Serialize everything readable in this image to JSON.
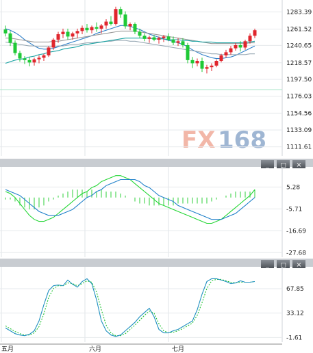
{
  "chart_data": [
    {
      "type": "candlestick",
      "panel": "price",
      "ylim": [
        1100,
        1295
      ],
      "yticks": [
        1283.39,
        1261.52,
        1240.65,
        1218.57,
        1197.5,
        1176.03,
        1154.56,
        1133.09,
        1111.61
      ],
      "candles": [
        [
          1261,
          1266,
          1252,
          1256
        ],
        [
          1256,
          1259,
          1240,
          1244
        ],
        [
          1244,
          1247,
          1228,
          1231
        ],
        [
          1231,
          1234,
          1220,
          1224
        ],
        [
          1224,
          1227,
          1217,
          1222
        ],
        [
          1222,
          1226,
          1214,
          1219
        ],
        [
          1219,
          1225,
          1215,
          1223
        ],
        [
          1223,
          1228,
          1218,
          1225
        ],
        [
          1225,
          1230,
          1221,
          1228
        ],
        [
          1228,
          1240,
          1226,
          1238
        ],
        [
          1238,
          1250,
          1235,
          1248
        ],
        [
          1248,
          1258,
          1244,
          1255
        ],
        [
          1255,
          1262,
          1250,
          1258
        ],
        [
          1258,
          1262,
          1248,
          1252
        ],
        [
          1252,
          1258,
          1248,
          1256
        ],
        [
          1256,
          1262,
          1250,
          1259
        ],
        [
          1259,
          1266,
          1255,
          1263
        ],
        [
          1263,
          1268,
          1257,
          1260
        ],
        [
          1260,
          1266,
          1256,
          1264
        ],
        [
          1264,
          1270,
          1258,
          1262
        ],
        [
          1262,
          1268,
          1256,
          1266
        ],
        [
          1266,
          1274,
          1262,
          1271
        ],
        [
          1271,
          1278,
          1266,
          1268
        ],
        [
          1268,
          1290,
          1266,
          1287
        ],
        [
          1287,
          1290,
          1276,
          1280
        ],
        [
          1280,
          1284,
          1262,
          1265
        ],
        [
          1265,
          1270,
          1260,
          1268
        ],
        [
          1268,
          1270,
          1255,
          1258
        ],
        [
          1258,
          1262,
          1250,
          1253
        ],
        [
          1253,
          1256,
          1246,
          1249
        ],
        [
          1249,
          1253,
          1244,
          1251
        ],
        [
          1251,
          1254,
          1246,
          1248
        ],
        [
          1248,
          1252,
          1243,
          1250
        ],
        [
          1250,
          1254,
          1245,
          1252
        ],
        [
          1252,
          1256,
          1246,
          1248
        ],
        [
          1248,
          1252,
          1241,
          1244
        ],
        [
          1244,
          1250,
          1240,
          1246
        ],
        [
          1246,
          1250,
          1238,
          1241
        ],
        [
          1241,
          1244,
          1218,
          1222
        ],
        [
          1222,
          1226,
          1212,
          1218
        ],
        [
          1218,
          1224,
          1214,
          1221
        ],
        [
          1221,
          1225,
          1207,
          1211
        ],
        [
          1211,
          1216,
          1205,
          1213
        ],
        [
          1213,
          1218,
          1208,
          1215
        ],
        [
          1215,
          1223,
          1213,
          1221
        ],
        [
          1221,
          1230,
          1219,
          1228
        ],
        [
          1228,
          1235,
          1225,
          1232
        ],
        [
          1232,
          1240,
          1229,
          1237
        ],
        [
          1237,
          1244,
          1234,
          1241
        ],
        [
          1241,
          1246,
          1233,
          1238
        ],
        [
          1238,
          1248,
          1235,
          1246
        ],
        [
          1246,
          1256,
          1243,
          1253
        ],
        [
          1253,
          1262,
          1250,
          1260
        ]
      ],
      "ma_series": [
        {
          "color": "#2e7fc8",
          "values": [
            1262,
            1260,
            1257,
            1253,
            1248,
            1244,
            1240,
            1237,
            1236,
            1236,
            1237,
            1239,
            1241,
            1243,
            1245,
            1247,
            1249,
            1251,
            1253,
            1256,
            1258,
            1260,
            1262,
            1264,
            1266,
            1266,
            1265,
            1263,
            1261,
            1258,
            1255,
            1253,
            1251,
            1249,
            1247,
            1246,
            1244,
            1242,
            1239,
            1235,
            1232,
            1229,
            1227,
            1225,
            1224,
            1224,
            1225,
            1226,
            1228,
            1231,
            1234,
            1237,
            1240
          ]
        },
        {
          "color": "#999999",
          "values": [
            1250,
            1250,
            1249,
            1248,
            1247,
            1246,
            1245,
            1245,
            1245,
            1245,
            1246,
            1246,
            1247,
            1248,
            1249,
            1250,
            1251,
            1252,
            1253,
            1254,
            1255,
            1256,
            1257,
            1258,
            1259,
            1259,
            1259,
            1259,
            1258,
            1257,
            1256,
            1255,
            1254,
            1253,
            1252,
            1251,
            1250,
            1249,
            1248,
            1247,
            1246,
            1245,
            1244,
            1243,
            1243,
            1243,
            1243,
            1243,
            1243,
            1243,
            1243,
            1244,
            1244
          ]
        },
        {
          "color": "#9aaab5",
          "values": [
            1245,
            1244,
            1243,
            1242,
            1241,
            1240,
            1240,
            1239,
            1239,
            1239,
            1239,
            1240,
            1240,
            1241,
            1242,
            1242,
            1243,
            1244,
            1244,
            1245,
            1245,
            1246,
            1246,
            1247,
            1247,
            1247,
            1246,
            1246,
            1245,
            1244,
            1243,
            1242,
            1241,
            1240,
            1239,
            1238,
            1237,
            1236,
            1235,
            1234,
            1233,
            1232,
            1231,
            1230,
            1230,
            1229,
            1229,
            1229,
            1229,
            1229,
            1229,
            1230,
            1230
          ]
        },
        {
          "color": "#1aa3a3",
          "values": [
            1218,
            1220,
            1222,
            1223,
            1224,
            1226,
            1227,
            1229,
            1230,
            1232,
            1233,
            1234,
            1236,
            1237,
            1238,
            1239,
            1241,
            1242,
            1243,
            1244,
            1245,
            1246,
            1247,
            1248,
            1249,
            1250,
            1250,
            1250,
            1250,
            1250,
            1250,
            1249,
            1249,
            1249,
            1248,
            1248,
            1248,
            1247,
            1247,
            1246,
            1246,
            1245,
            1245,
            1245,
            1244,
            1244,
            1244,
            1244,
            1244,
            1244,
            1245,
            1245,
            1246
          ]
        }
      ]
    },
    {
      "type": "histogram+line",
      "panel": "macd",
      "ylim": [
        -30,
        14
      ],
      "yticks": [
        5.28,
        -5.71,
        -16.69,
        -27.68
      ],
      "line_green": [
        3,
        2,
        0,
        -3,
        -6,
        -9,
        -11,
        -12,
        -12,
        -11,
        -10,
        -8,
        -6,
        -4,
        -2,
        0,
        2,
        3,
        5,
        6,
        8,
        9,
        10,
        11,
        11,
        10,
        9,
        7,
        5,
        3,
        1,
        -1,
        -3,
        -4,
        -5,
        -6,
        -7,
        -8,
        -9,
        -10,
        -11,
        -12,
        -13,
        -13,
        -12,
        -11,
        -9,
        -7,
        -5,
        -3,
        -1,
        1,
        4
      ],
      "line_blue": [
        4,
        3,
        2,
        1,
        -1,
        -3,
        -5,
        -7,
        -8,
        -9,
        -9,
        -9,
        -8,
        -7,
        -6,
        -4,
        -2,
        0,
        1,
        3,
        4,
        6,
        7,
        8,
        9,
        9,
        9,
        9,
        8,
        6,
        5,
        3,
        1,
        0,
        -1,
        -2,
        -4,
        -5,
        -6,
        -7,
        -8,
        -9,
        -10,
        -11,
        -11,
        -11,
        -10,
        -9,
        -8,
        -6,
        -4,
        -2,
        0
      ],
      "histogram": [
        -1,
        -1,
        -2,
        -4,
        -5,
        -6,
        -6,
        -5,
        -4,
        -2,
        -1,
        1,
        2,
        3,
        4,
        4,
        4,
        3,
        4,
        3,
        4,
        3,
        3,
        3,
        2,
        1,
        0,
        -2,
        -3,
        -3,
        -4,
        -4,
        -4,
        -4,
        -4,
        -4,
        -3,
        -3,
        -3,
        -3,
        -3,
        -3,
        -3,
        -2,
        -1,
        0,
        1,
        2,
        3,
        3,
        3,
        3,
        4
      ]
    },
    {
      "type": "line",
      "panel": "stochastic",
      "ylim": [
        -8,
        95
      ],
      "yticks": [
        67.85,
        33.12,
        -1.61
      ],
      "line_blue": [
        12,
        8,
        4,
        2,
        1,
        3,
        8,
        22,
        45,
        65,
        72,
        73,
        72,
        80,
        74,
        70,
        78,
        82,
        75,
        52,
        22,
        8,
        2,
        0,
        2,
        8,
        14,
        20,
        28,
        34,
        40,
        28,
        10,
        5,
        5,
        8,
        10,
        14,
        18,
        22,
        38,
        60,
        78,
        82,
        82,
        80,
        78,
        75,
        76,
        79,
        77,
        77,
        78
      ],
      "line_green": [
        15,
        11,
        7,
        4,
        2,
        2,
        5,
        14,
        32,
        55,
        68,
        72,
        72,
        76,
        75,
        72,
        75,
        79,
        77,
        63,
        38,
        16,
        5,
        1,
        1,
        4,
        10,
        16,
        23,
        30,
        36,
        33,
        18,
        8,
        5,
        6,
        8,
        11,
        15,
        19,
        30,
        48,
        68,
        79,
        81,
        81,
        79,
        77,
        76,
        77,
        77,
        77,
        78
      ]
    }
  ],
  "x_axis": {
    "labels": [
      "五月",
      "六月",
      "七月"
    ]
  },
  "watermark": {
    "fx": "FX",
    "num": "168"
  },
  "panel_buttons": [
    "_",
    "□",
    "×"
  ],
  "colors": {
    "up": "#e0262d",
    "down": "#1fc936",
    "watermark_fx": "#f2b7a8",
    "watermark_num": "#9fb6d3"
  }
}
